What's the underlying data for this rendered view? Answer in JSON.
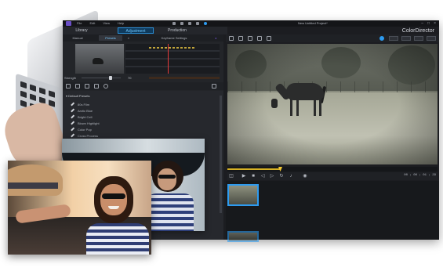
{
  "app": {
    "project_title": "New Untitled Project*",
    "brand": "ColorDirector",
    "menu": [
      "File",
      "Edit",
      "View",
      "Help"
    ],
    "window_buttons": [
      "–",
      "□",
      "×"
    ]
  },
  "main_tabs": [
    {
      "label": "Library",
      "active": false
    },
    {
      "label": "Adjustment",
      "active": true
    },
    {
      "label": "Production",
      "active": false
    }
  ],
  "sub_tabs": [
    {
      "label": "Manual",
      "active": false
    },
    {
      "label": "Presets",
      "active": true
    },
    {
      "label": "Keyframe Settings",
      "active": false
    }
  ],
  "strength": {
    "label": "Strength",
    "value": "70",
    "level": 0.7
  },
  "presets": {
    "group": "Default Presets",
    "items": [
      "80s Film",
      "Arctic Blue",
      "Bright Cell",
      "Blown Highlight",
      "Color Pop",
      "Cross Process"
    ]
  },
  "timeline": {
    "progress": 0.25
  },
  "timecode": "00 ; 00 ; 01 ; 29",
  "icons": {
    "app_logo": "app-logo-icon",
    "edit": "pencil-icon",
    "play": "play-icon",
    "stop": "stop-icon"
  },
  "colors": {
    "accent": "#2d9bf0",
    "active_tab_text": "#6cc6ff",
    "timeline": "#d7b224",
    "playhead_marker": "#e53b3b"
  }
}
